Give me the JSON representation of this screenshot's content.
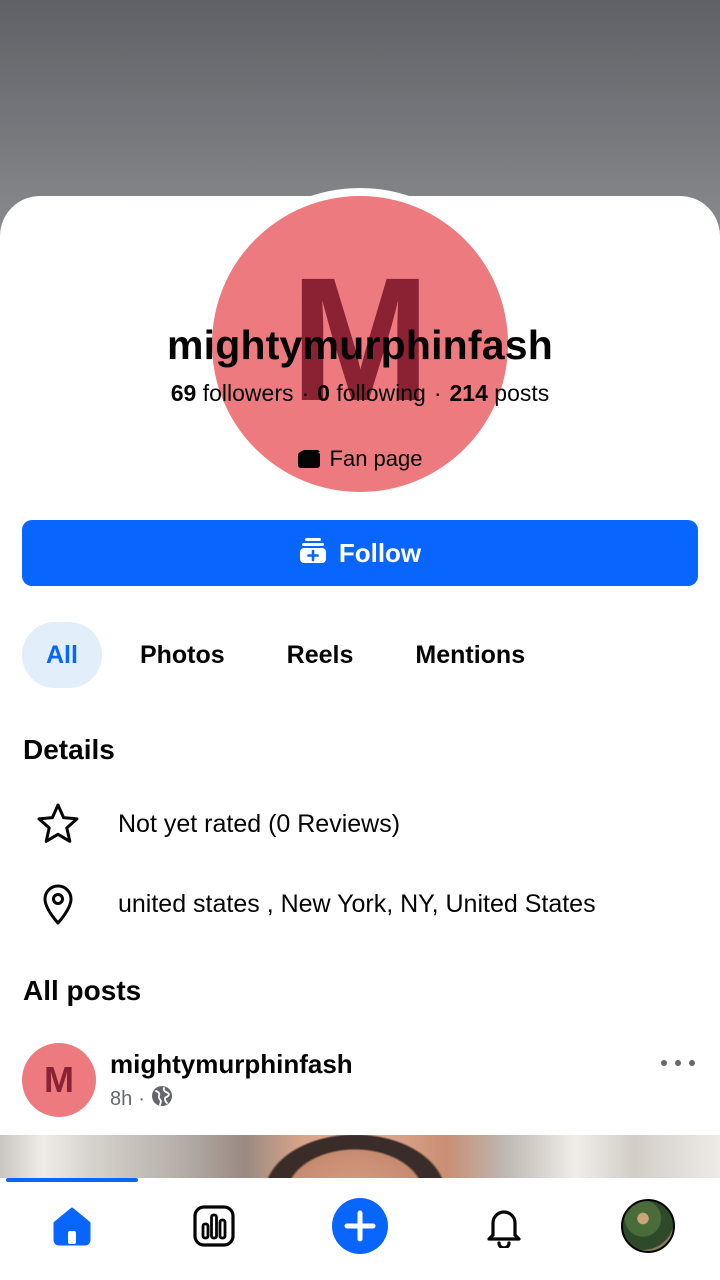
{
  "profile": {
    "avatar_letter": "M",
    "name": "mightymurphinfash",
    "followers_count": "69",
    "followers_label": "followers",
    "following_count": "0",
    "following_label": "following",
    "posts_count": "214",
    "posts_label": "posts",
    "separator": "·",
    "category": "Fan page",
    "category_icon": "clapperboard-icon"
  },
  "follow_button": {
    "label": "Follow",
    "icon": "add-friend-icon"
  },
  "tabs": [
    {
      "label": "All",
      "active": true
    },
    {
      "label": "Photos",
      "active": false
    },
    {
      "label": "Reels",
      "active": false
    },
    {
      "label": "Mentions",
      "active": false
    }
  ],
  "details": {
    "title": "Details",
    "rating": {
      "icon": "star-icon",
      "text": "Not yet rated (0 Reviews)"
    },
    "location": {
      "icon": "location-pin-icon",
      "text": "united states , New York, NY, United States"
    }
  },
  "posts": {
    "title": "All posts",
    "items": [
      {
        "avatar_letter": "M",
        "author": "mightymurphinfash",
        "time": "8h",
        "separator": "·",
        "audience_icon": "globe-icon"
      }
    ]
  },
  "bottom_nav": {
    "items": [
      "home-icon",
      "dashboard-icon",
      "create-plus-icon",
      "notifications-bell-icon",
      "profile-avatar"
    ],
    "active": "home-icon"
  },
  "colors": {
    "accent": "#0866ff",
    "avatar_bg": "#ec7a7e",
    "avatar_letter": "#8b2233",
    "tab_active_bg": "#e3eefb",
    "secondary_text": "#65676b"
  }
}
